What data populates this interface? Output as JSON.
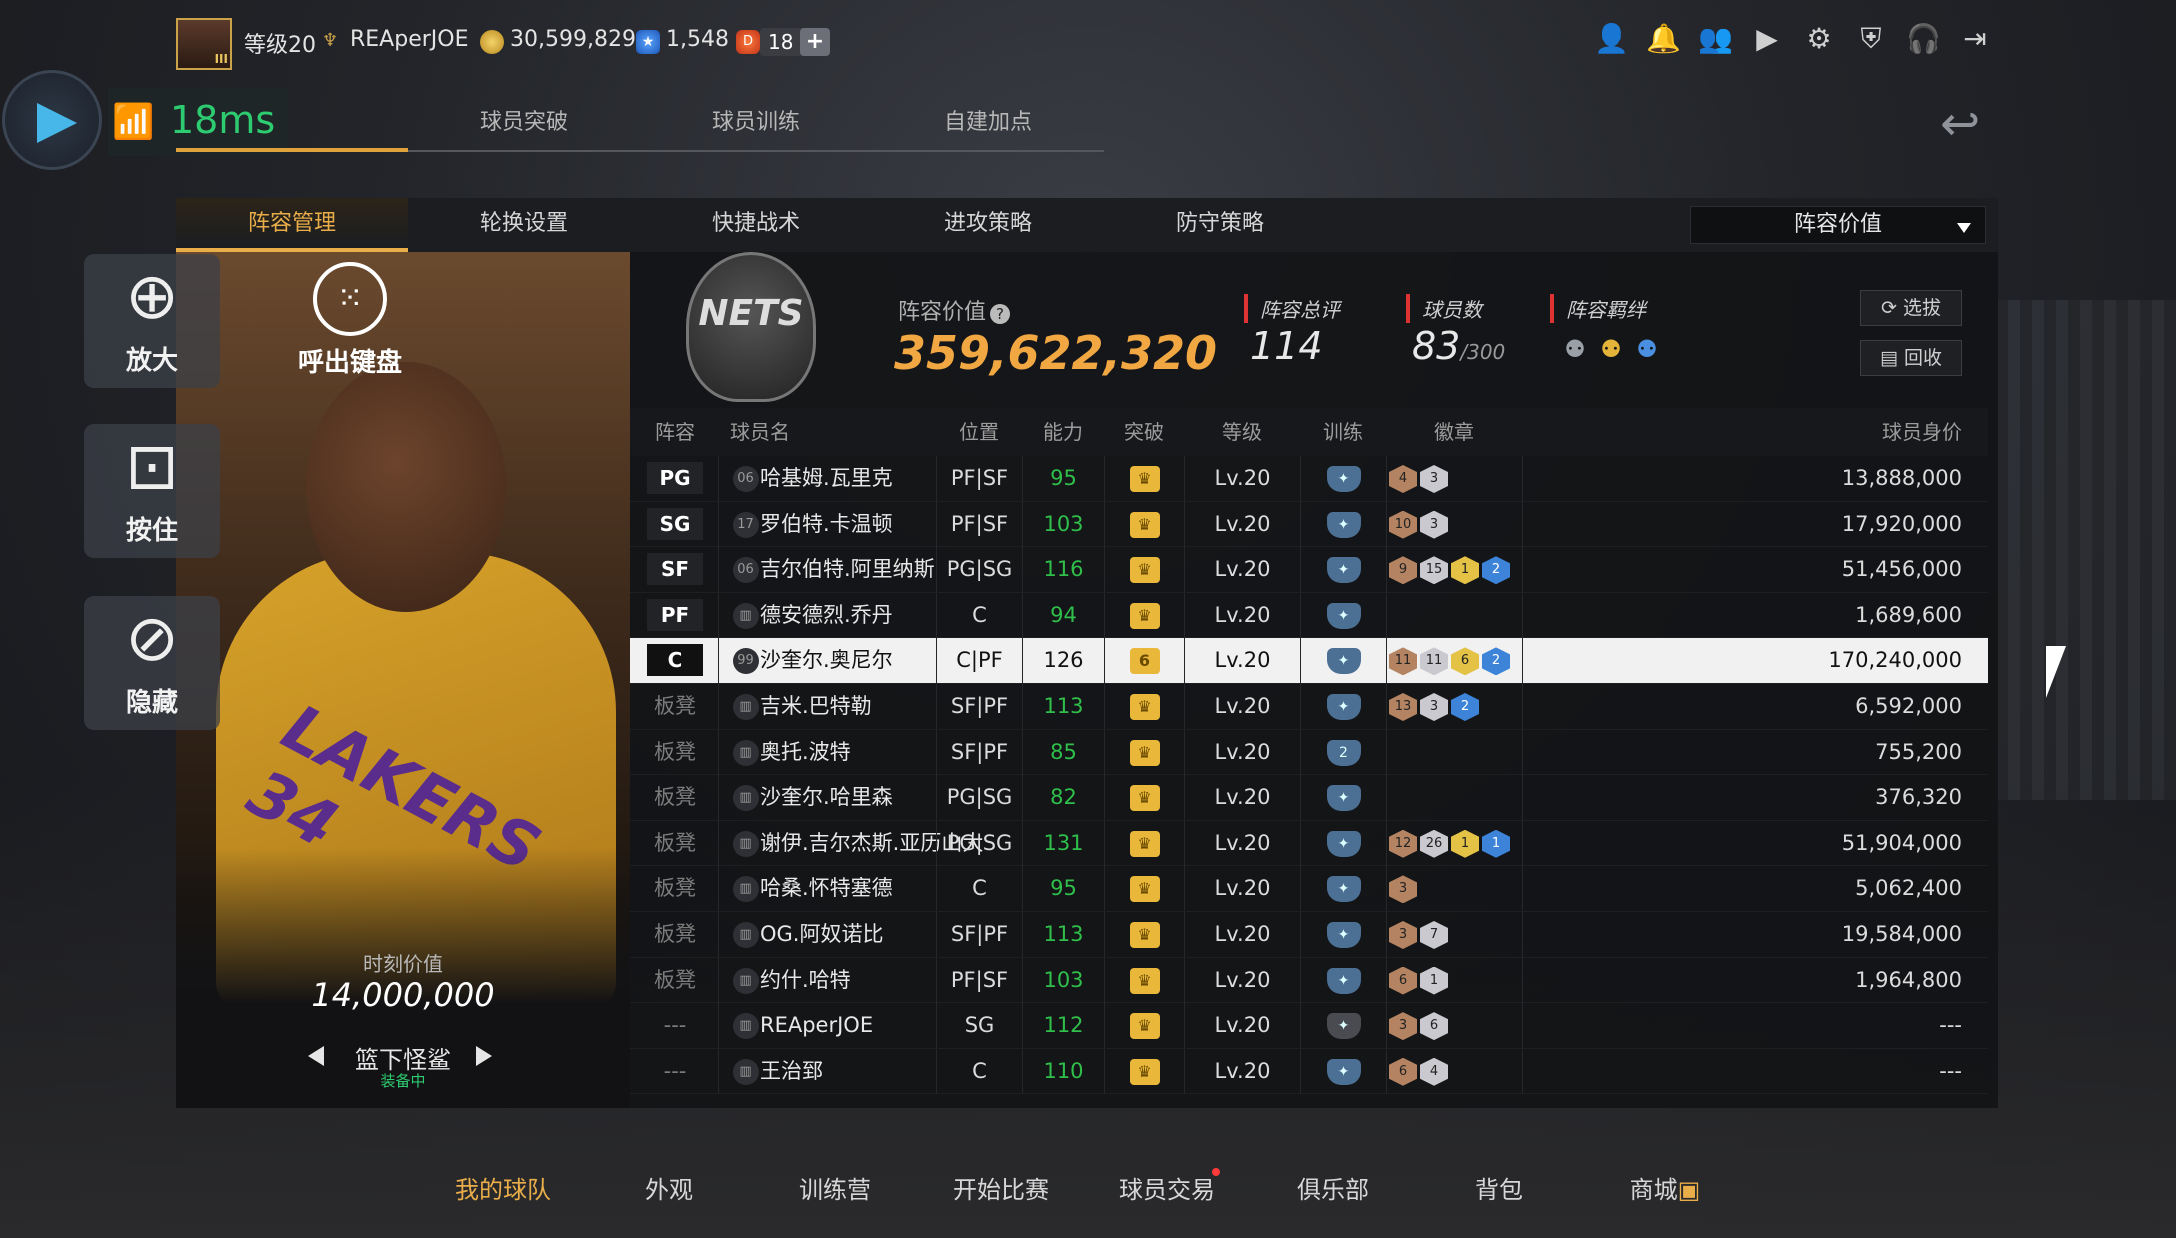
{
  "topbar": {
    "level": "等级20",
    "username": "REAperJOE",
    "gold": "30,599,829",
    "stars": "1,548",
    "tickets": "18",
    "plus": "+",
    "avatar_tag": "III"
  },
  "ping": {
    "value": "18ms"
  },
  "subtabs": [
    "",
    "球员突破",
    "球员训练",
    "自建加点"
  ],
  "tabs": [
    "阵容管理",
    "轮换设置",
    "快捷战术",
    "进攻策略",
    "防守策略"
  ],
  "sort_select": {
    "value": "阵容价值"
  },
  "overlay": {
    "zoom": "放大",
    "hold": "按住",
    "hide": "隐藏",
    "keyboard": "呼出键盘"
  },
  "card": {
    "moment_label": "时刻价值",
    "moment_value": "14,000,000",
    "skin_name": "篮下怪鲨",
    "skin_status": "装备中",
    "jersey_text": "LAKERS",
    "jersey_number": "34"
  },
  "team": {
    "logo_text": "NETS",
    "value_label": "阵容价值",
    "value": "359,622,320",
    "rating_label": "阵容总评",
    "rating": "114",
    "count_label": "球员数",
    "count": "83",
    "count_max": "/300",
    "bond_label": "阵容羁绊",
    "scout_button": "选拔",
    "recycle_button": "回收"
  },
  "table": {
    "headers": [
      "阵容",
      "球员名",
      "位置",
      "能力",
      "突破",
      "等级",
      "训练",
      "徽章",
      "球员身价"
    ],
    "rows": [
      {
        "lineup": "PG",
        "num": "06",
        "name": "哈基姆.瓦里克",
        "pos": "PF|SF",
        "ovr": "95",
        "brk": "",
        "lv": "Lv.20",
        "train": "",
        "badges": [
          [
            "b-bronze",
            "4"
          ],
          [
            "b-silver",
            "3"
          ]
        ],
        "price": "13,888,000"
      },
      {
        "lineup": "SG",
        "num": "17",
        "name": "罗伯特.卡温顿",
        "pos": "PF|SF",
        "ovr": "103",
        "brk": "",
        "lv": "Lv.20",
        "train": "",
        "badges": [
          [
            "b-bronze",
            "10"
          ],
          [
            "b-silver",
            "3"
          ]
        ],
        "price": "17,920,000"
      },
      {
        "lineup": "SF",
        "num": "06",
        "name": "吉尔伯特.阿里纳斯",
        "pos": "PG|SG",
        "ovr": "116",
        "brk": "",
        "lv": "Lv.20",
        "train": "",
        "badges": [
          [
            "b-bronze",
            "9"
          ],
          [
            "b-silver",
            "15"
          ],
          [
            "b-gold",
            "1"
          ],
          [
            "b-blue",
            "2"
          ]
        ],
        "price": "51,456,000"
      },
      {
        "lineup": "PF",
        "num": "",
        "name": "德安德烈.乔丹",
        "pos": "C",
        "ovr": "94",
        "brk": "",
        "lv": "Lv.20",
        "train": "",
        "badges": [],
        "price": "1,689,600"
      },
      {
        "lineup": "C",
        "num": "99",
        "name": "沙奎尔.奥尼尔",
        "pos": "C|PF",
        "ovr": "126",
        "brk": "6",
        "lv": "Lv.20",
        "train": "",
        "badges": [
          [
            "b-bronze",
            "11"
          ],
          [
            "b-silver",
            "11"
          ],
          [
            "b-gold",
            "6"
          ],
          [
            "b-blue",
            "2"
          ]
        ],
        "price": "170,240,000"
      },
      {
        "lineup": "板凳",
        "num": "",
        "name": "吉米.巴特勒",
        "pos": "SF|PF",
        "ovr": "113",
        "brk": "",
        "lv": "Lv.20",
        "train": "",
        "badges": [
          [
            "b-bronze",
            "13"
          ],
          [
            "b-silver",
            "3"
          ],
          [
            "b-blue",
            "2"
          ]
        ],
        "price": "6,592,000"
      },
      {
        "lineup": "板凳",
        "num": "",
        "name": "奥托.波特",
        "pos": "SF|PF",
        "ovr": "85",
        "brk": "",
        "lv": "Lv.20",
        "train": "2",
        "badges": [],
        "price": "755,200"
      },
      {
        "lineup": "板凳",
        "num": "",
        "name": "沙奎尔.哈里森",
        "pos": "PG|SG",
        "ovr": "82",
        "brk": "",
        "lv": "Lv.20",
        "train": "",
        "badges": [],
        "price": "376,320"
      },
      {
        "lineup": "板凳",
        "num": "",
        "name": "谢伊.吉尔杰斯.亚历山大",
        "pos": "PG|SG",
        "ovr": "131",
        "brk": "",
        "lv": "Lv.20",
        "train": "",
        "badges": [
          [
            "b-bronze",
            "12"
          ],
          [
            "b-silver",
            "26"
          ],
          [
            "b-gold",
            "1"
          ],
          [
            "b-blue",
            "1"
          ]
        ],
        "price": "51,904,000"
      },
      {
        "lineup": "板凳",
        "num": "",
        "name": "哈桑.怀特塞德",
        "pos": "C",
        "ovr": "95",
        "brk": "",
        "lv": "Lv.20",
        "train": "",
        "badges": [
          [
            "b-bronze",
            "3"
          ]
        ],
        "price": "5,062,400"
      },
      {
        "lineup": "板凳",
        "num": "",
        "name": "OG.阿奴诺比",
        "pos": "SF|PF",
        "ovr": "113",
        "brk": "",
        "lv": "Lv.20",
        "train": "",
        "badges": [
          [
            "b-bronze",
            "3"
          ],
          [
            "b-silver",
            "7"
          ]
        ],
        "price": "19,584,000"
      },
      {
        "lineup": "板凳",
        "num": "",
        "name": "约什.哈特",
        "pos": "PF|SF",
        "ovr": "103",
        "brk": "",
        "lv": "Lv.20",
        "train": "",
        "badges": [
          [
            "b-bronze",
            "6"
          ],
          [
            "b-silver",
            "1"
          ]
        ],
        "price": "1,964,800"
      },
      {
        "lineup": "---",
        "num": "",
        "name": "REAperJOE",
        "pos": "SG",
        "ovr": "112",
        "brk": "",
        "lv": "Lv.20",
        "train": "",
        "badges": [
          [
            "b-bronze",
            "3"
          ],
          [
            "b-silver",
            "6"
          ]
        ],
        "price": "---"
      },
      {
        "lineup": "---",
        "num": "",
        "name": "王治郅",
        "pos": "C",
        "ovr": "110",
        "brk": "",
        "lv": "Lv.20",
        "train": "",
        "badges": [
          [
            "b-bronze",
            "6"
          ],
          [
            "b-silver",
            "4"
          ]
        ],
        "price": "---"
      }
    ]
  },
  "bottom_nav": [
    "我的球队",
    "外观",
    "训练营",
    "开始比赛",
    "球员交易",
    "俱乐部",
    "背包",
    "商城"
  ],
  "colors": {
    "accent": "#e9ad4a",
    "value": "#f1a843",
    "ovr": "#2fbf4a",
    "ping": "#2ecc71"
  }
}
